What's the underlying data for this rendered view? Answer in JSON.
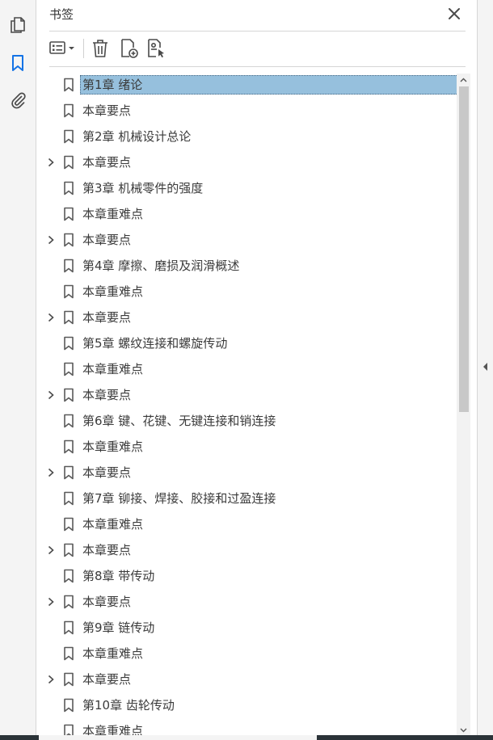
{
  "panel": {
    "title": "书签"
  },
  "bookmarks": [
    {
      "label": "第1章  绪论",
      "expandable": false,
      "selected": true
    },
    {
      "label": "本章要点",
      "expandable": false
    },
    {
      "label": "第2章  机械设计总论",
      "expandable": false
    },
    {
      "label": "本章要点",
      "expandable": true
    },
    {
      "label": "第3章  机械零件的强度",
      "expandable": false
    },
    {
      "label": "本章重难点",
      "expandable": false
    },
    {
      "label": "本章要点",
      "expandable": true
    },
    {
      "label": "第4章  摩擦、磨损及润滑概述",
      "expandable": false
    },
    {
      "label": "本章重难点",
      "expandable": false
    },
    {
      "label": "本章要点",
      "expandable": true
    },
    {
      "label": "第5章  螺纹连接和螺旋传动",
      "expandable": false
    },
    {
      "label": "本章重难点",
      "expandable": false
    },
    {
      "label": "本章要点",
      "expandable": true
    },
    {
      "label": "第6章  键、花键、无键连接和销连接",
      "expandable": false
    },
    {
      "label": "本章重难点",
      "expandable": false
    },
    {
      "label": "本章要点",
      "expandable": true
    },
    {
      "label": "第7章  铆接、焊接、胶接和过盈连接",
      "expandable": false
    },
    {
      "label": "本章重难点",
      "expandable": false
    },
    {
      "label": "本章要点",
      "expandable": true
    },
    {
      "label": "第8章  带传动",
      "expandable": false
    },
    {
      "label": "本章要点",
      "expandable": true
    },
    {
      "label": "第9章  链传动",
      "expandable": false
    },
    {
      "label": "本章重难点",
      "expandable": false
    },
    {
      "label": "本章要点",
      "expandable": true
    },
    {
      "label": "第10章  齿轮传动",
      "expandable": false
    },
    {
      "label": "本章重难点",
      "expandable": false
    }
  ],
  "icons": {
    "rail": [
      "pages-icon",
      "bookmark-panel-icon",
      "attachment-icon"
    ],
    "toolbar": [
      "options-menu-icon",
      "delete-bookmark-icon",
      "new-bookmark-icon",
      "new-bookmark-from-structure-icon"
    ]
  },
  "colors": {
    "accent": "#1473e6",
    "selection": "#96c0dd",
    "icon": "#4b4b4b",
    "scroll_thumb": "#c8c8c8"
  },
  "scroll": {
    "position_fraction": 0.0,
    "visible_fraction": 0.5
  }
}
